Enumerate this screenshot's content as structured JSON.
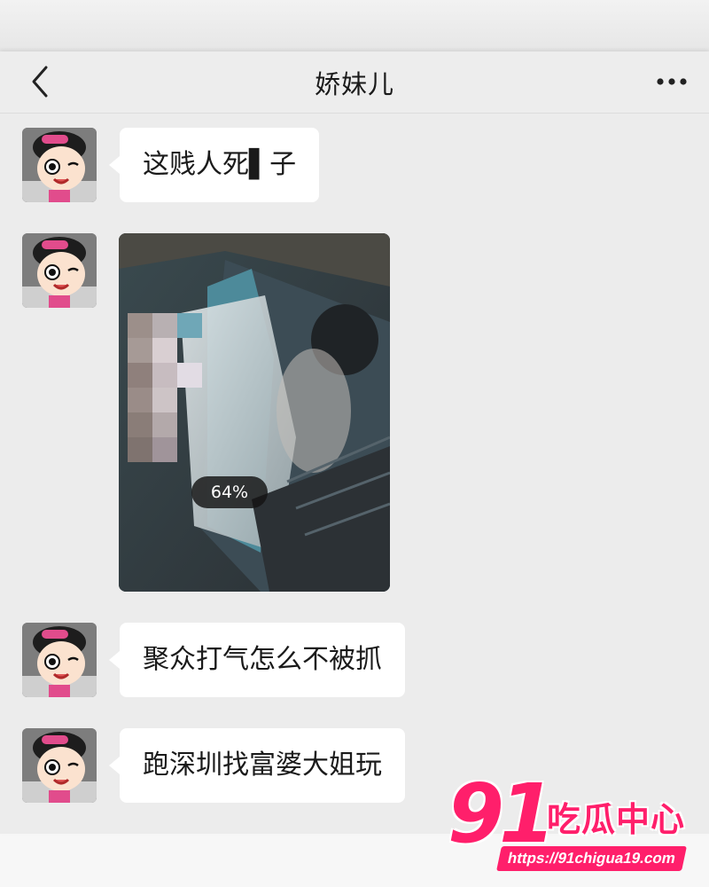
{
  "header": {
    "back_icon": "chevron-left-icon",
    "title": "娇妹儿",
    "more_icon": "more-dots-icon"
  },
  "messages": [
    {
      "type": "text",
      "sender": "other",
      "text": "这贱人死▌子"
    },
    {
      "type": "image",
      "sender": "other",
      "progress_label": "64%",
      "progress": 0.64
    },
    {
      "type": "text",
      "sender": "other",
      "text": "聚众打气怎么不被抓"
    },
    {
      "type": "text",
      "sender": "other",
      "text": "跑深圳找富婆大姐玩"
    }
  ],
  "watermark": {
    "number": "91",
    "name": "吃瓜中心",
    "url": "https://91chigua19.com"
  },
  "colors": {
    "chat_bg": "#ececec",
    "bubble_bg": "#ffffff",
    "brand_pink": "#ff1f6b"
  }
}
